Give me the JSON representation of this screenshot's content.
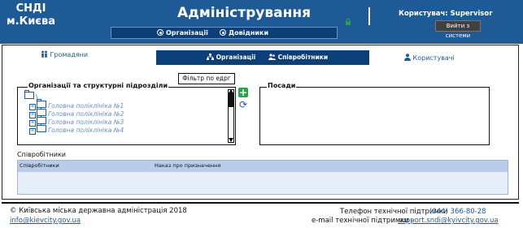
{
  "header": {
    "logo_line1": "СНДІ",
    "logo_line2": "м.Києва",
    "title": "Адміністрування",
    "nav": [
      {
        "label": "Організації",
        "icon": "radio-icon"
      },
      {
        "label": "Довідники",
        "icon": "radio-icon"
      }
    ],
    "user_label": "Користувач: Supervisor",
    "logout_label": "Вийти з системи",
    "lock_icon": "lock-icon"
  },
  "tabs": {
    "citizens": "Громадяни",
    "organizations": "Організації",
    "employees": "Співробітники",
    "users": "Користувачі"
  },
  "org_panel": {
    "title": "Організації та структурні підрозділи",
    "filter_label": "Фільтр по едрг",
    "root": "\\",
    "items": [
      "Головна поліклініка №1",
      "Головна поліклініка №2",
      "Головна поліклініка №3",
      "Головна поліклініка №4"
    ]
  },
  "actions": {
    "add": "+",
    "refresh": "⟳"
  },
  "positions_panel": {
    "title": "Посади"
  },
  "employees": {
    "title": "Співробітники",
    "columns": [
      "Співробітники",
      "Наказ про призначення"
    ]
  },
  "footer": {
    "copyright": "©  Київська міська державна адміністрація 2018",
    "email": "info@kievcity.gov.ua",
    "phone_label": "Телефон технічної підтримки",
    "phone": "(044) 366-80-28",
    "tech_email_label": "e-mail технічної підтримки -",
    "tech_email": "support.sndi@kyivcity.gov.ua"
  },
  "colors": {
    "header_bg": "#1d5a96",
    "nav_bg": "#0c3f78",
    "accent_green": "#2ea24a"
  }
}
